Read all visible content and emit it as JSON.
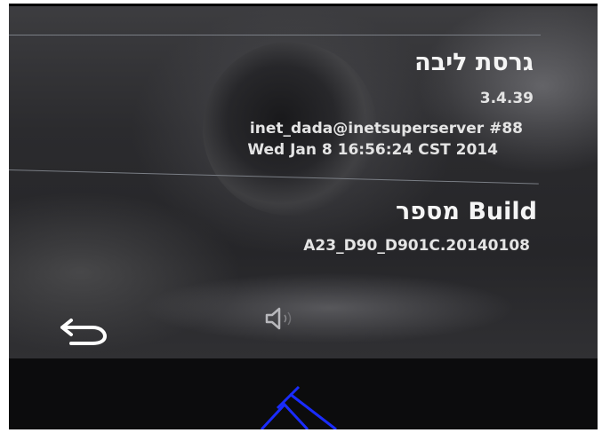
{
  "about": {
    "kernel_title": "גרסת ליבה",
    "kernel_version": "3.4.39",
    "kernel_builder": "inet_dada@inetsuperserver #88",
    "kernel_date": "Wed Jan 8 16:56:24 CST 2014",
    "build_title": "מספר Build",
    "build_number": "A23_D90_D901C.20140108"
  },
  "navigation": {
    "back_icon": "back-arrow-icon",
    "volume_icon": "volume-icon"
  },
  "colors": {
    "screen_bg": "#2b2b2e",
    "text": "#f0f0f0",
    "divider": "#7a7e85",
    "bezel": "#0c0c0d",
    "mark": "#1a2cff"
  }
}
